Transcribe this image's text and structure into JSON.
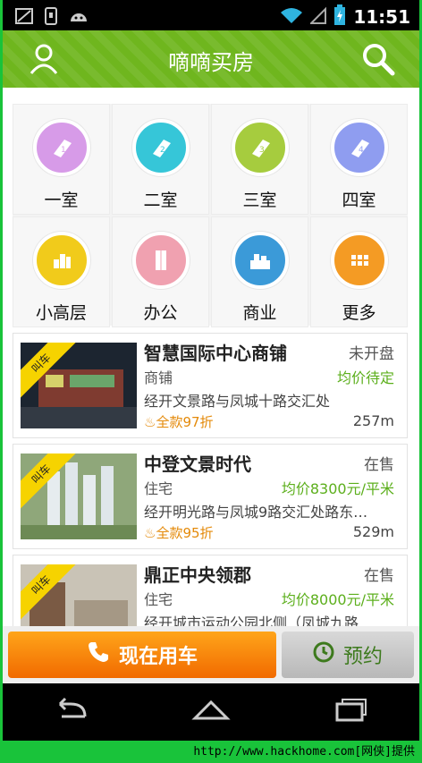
{
  "statusbar": {
    "time": "11:51"
  },
  "appbar": {
    "title": "嘀嘀买房"
  },
  "categories": [
    {
      "label": "一室",
      "color": "#d79be8",
      "icon": "tag-1-icon",
      "num": "1"
    },
    {
      "label": "二室",
      "color": "#36c6d8",
      "icon": "tag-2-icon",
      "num": "2"
    },
    {
      "label": "三室",
      "color": "#a6cc3e",
      "icon": "tag-3-icon",
      "num": "3"
    },
    {
      "label": "四室",
      "color": "#8f9df0",
      "icon": "tag-4-icon",
      "num": "4"
    },
    {
      "label": "小高层",
      "color": "#f1cb1b",
      "icon": "high-rise-icon"
    },
    {
      "label": "办公",
      "color": "#f0a1b0",
      "icon": "office-icon"
    },
    {
      "label": "商业",
      "color": "#3b9ad8",
      "icon": "commercial-icon"
    },
    {
      "label": "更多",
      "color": "#f49b24",
      "icon": "more-icon"
    }
  ],
  "listings": [
    {
      "tag": "叫车",
      "name": "智慧国际中心商铺",
      "status": "未开盘",
      "type": "商铺",
      "price": "均价待定",
      "address": "经开文景路与凤城十路交汇处",
      "discount": "全款97折",
      "distance": "257m"
    },
    {
      "tag": "叫车",
      "name": "中登文景时代",
      "status": "在售",
      "type": "住宅",
      "price": "均价8300元/平米",
      "address": "经开明光路与凤城9路交汇处路东…",
      "discount": "全款95折",
      "distance": "529m"
    },
    {
      "tag": "叫车",
      "name": "鼎正中央领郡",
      "status": "在售",
      "type": "住宅",
      "price": "均价8000元/平米",
      "address": "经开城市运动公园北侧（凤城九路…",
      "discount": "",
      "distance": ""
    }
  ],
  "actions": {
    "call": "现在用车",
    "book": "预约"
  },
  "footer": {
    "text": "http://www.hackhome.com[网侠]提供"
  }
}
